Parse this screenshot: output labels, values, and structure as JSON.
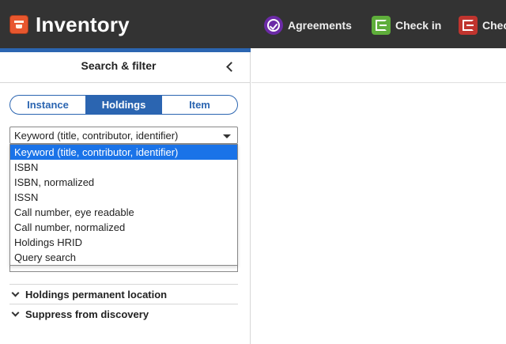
{
  "app": {
    "title": "Inventory",
    "icon": "inventory-app-icon"
  },
  "nav": {
    "items": [
      {
        "label": "Agreements",
        "icon": "agreements-icon",
        "color": "#6b2aa6"
      },
      {
        "label": "Check in",
        "icon": "check-in-icon",
        "color": "#5fae3b"
      },
      {
        "label": "Chec",
        "icon": "check-out-icon",
        "color": "#c0342e"
      }
    ]
  },
  "search_pane": {
    "title": "Search & filter",
    "segments": [
      {
        "label": "Instance",
        "active": false
      },
      {
        "label": "Holdings",
        "active": true
      },
      {
        "label": "Item",
        "active": false
      }
    ],
    "search_option": {
      "selected": "Keyword (title, contributor, identifier)",
      "options": [
        "Keyword (title, contributor, identifier)",
        "ISBN",
        "ISBN, normalized",
        "ISSN",
        "Call number, eye readable",
        "Call number, normalized",
        "Holdings HRID",
        "Query search"
      ]
    },
    "filters": [
      {
        "label": "Holdings permanent location"
      },
      {
        "label": "Suppress from discovery"
      }
    ]
  },
  "colors": {
    "topbar": "#333333",
    "accent": "#2b65b1",
    "selected_option": "#1a73e8"
  }
}
